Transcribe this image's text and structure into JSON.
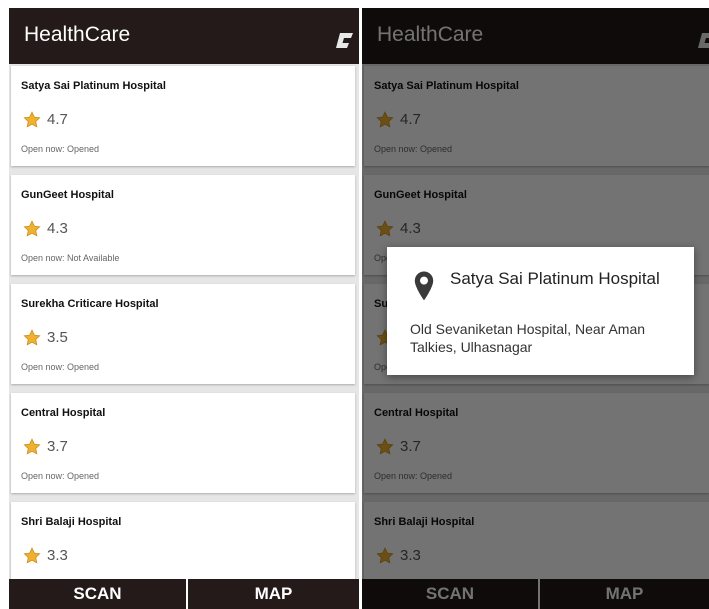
{
  "app": {
    "title": "HealthCare"
  },
  "colors": {
    "appbar": "#231a19",
    "star": "#f0b030",
    "dim_overlay": "rgba(0,0,0,0.55)"
  },
  "hospitals": [
    {
      "name": "Satya Sai Platinum Hospital",
      "rating": "4.7",
      "status": "Open now: Opened"
    },
    {
      "name": "GunGeet Hospital",
      "rating": "4.3",
      "status": "Open now: Not Available"
    },
    {
      "name": "Surekha Criticare Hospital",
      "rating": "3.5",
      "status": "Open now: Opened"
    },
    {
      "name": "Central Hospital",
      "rating": "3.7",
      "status": "Open now: Opened"
    },
    {
      "name": "Shri Balaji Hospital",
      "rating": "3.3",
      "status": ""
    }
  ],
  "nav": {
    "scan": "SCAN",
    "map": "MAP"
  },
  "dialog": {
    "title": "Satya Sai Platinum Hospital",
    "address": "Old Sevaniketan Hospital, Near Aman Talkies, Ulhasnagar",
    "icon": "location-pin-icon"
  }
}
